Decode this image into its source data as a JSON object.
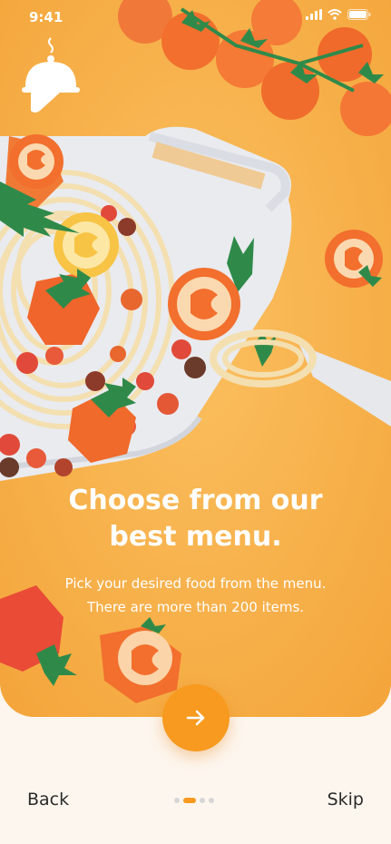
{
  "status_bar": {
    "time": "9:41"
  },
  "onboarding": {
    "headline_line1": "Choose from our",
    "headline_line2": "best menu.",
    "subtitle_line1": "Pick your desired food from the menu.",
    "subtitle_line2": "There are more than 200 items."
  },
  "pagination": {
    "total": 4,
    "active_index": 1
  },
  "nav": {
    "back_label": "Back",
    "skip_label": "Skip",
    "next_icon": "arrow-right-icon"
  },
  "colors": {
    "hero_background": "#f7b04a",
    "accent": "#f79a1f",
    "page_background": "#fdf6ee",
    "text_dark": "#2b2b2b"
  }
}
